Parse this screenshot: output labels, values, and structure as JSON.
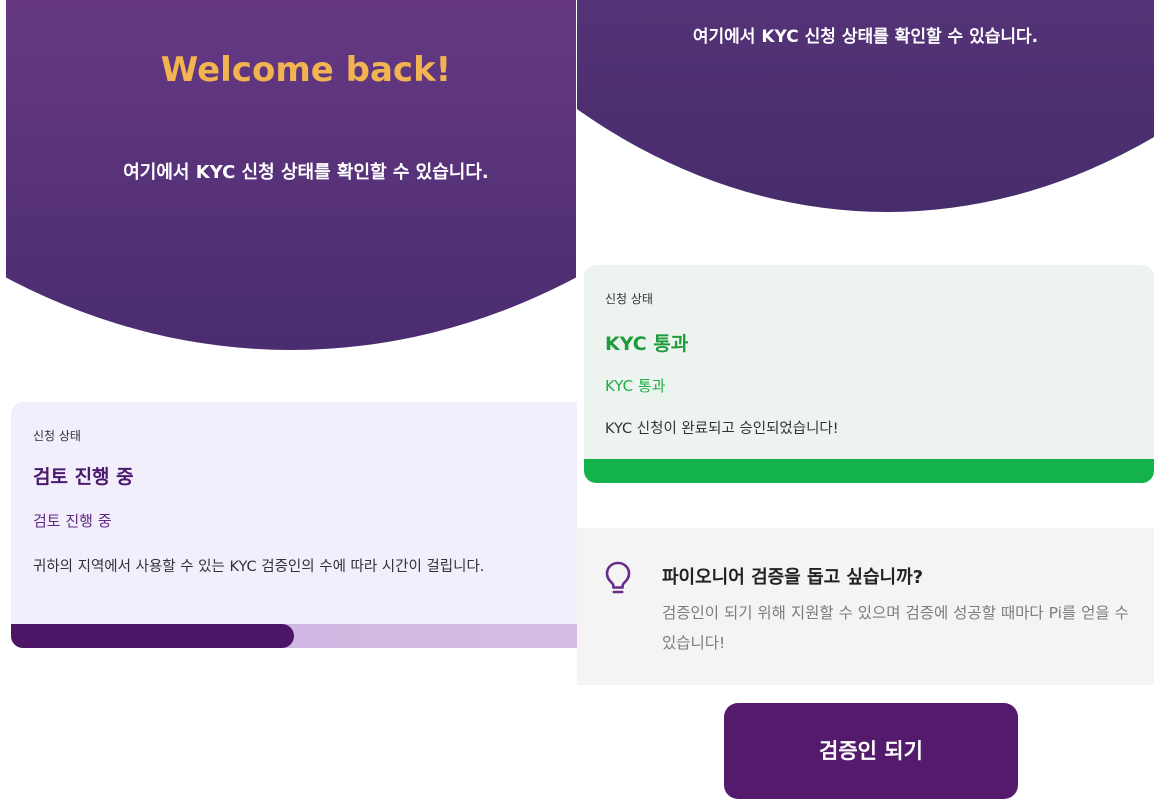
{
  "left": {
    "welcome": "Welcome back!",
    "subtitle": "여기에서 KYC 신청 상태를 확인할 수 있습니다.",
    "status_card": {
      "label": "신청 상태",
      "heading": "검토 진행 중",
      "status": "검토 진행 중",
      "description": "귀하의 지역에서 사용할 수 있는 KYC 검증인의 수에 따라 시간이 걸립니다.",
      "progress": 0.5,
      "colors": {
        "fill": "#4d1566",
        "track": "#d3bde4"
      }
    }
  },
  "right": {
    "subtitle": "여기에서 KYC 신청 상태를 확인할 수 있습니다.",
    "status_card": {
      "label": "신청 상태",
      "heading": "KYC 통과",
      "status": "KYC 통과",
      "description": "KYC 신청이 완료되고 승인되었습니다!",
      "progress": 1.0,
      "colors": {
        "fill": "#13b24a"
      }
    },
    "tip": {
      "icon": "lightbulb-icon",
      "title": "파이오니어 검증을 돕고 싶습니까?",
      "text": "검증인이 되기 위해 지원할 수 있으며 검증에 성공할 때마다 Pi를 얻을 수 있습니다!"
    },
    "cta_button": "검증인 되기"
  },
  "colors": {
    "hero_purple": "#5d357e",
    "welcome_gold": "#f2b450",
    "button_purple": "#541b6c",
    "success_green": "#13b24a"
  }
}
